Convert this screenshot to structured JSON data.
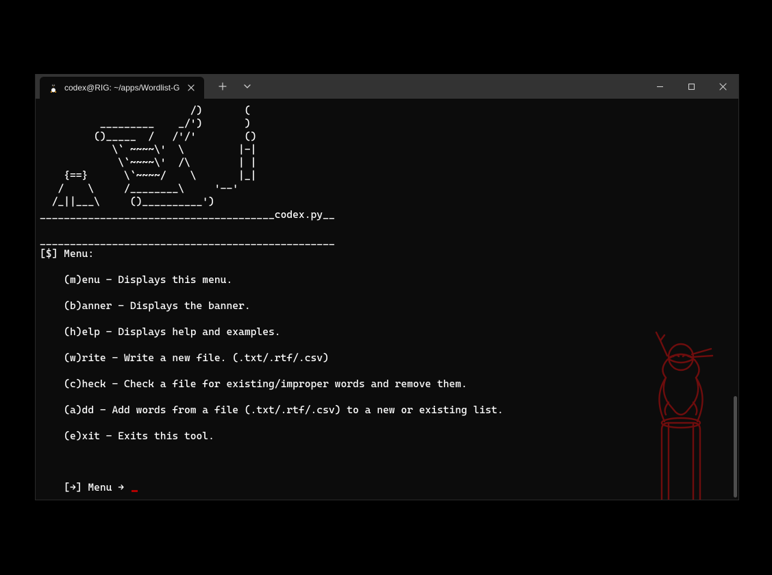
{
  "window": {
    "tab_title": "codex@RIG: ~/apps/Wordlist-G",
    "new_tab_aria": "New tab",
    "tab_dropdown_aria": "Tab options",
    "minimize_aria": "Minimize",
    "maximize_aria": "Maximize",
    "close_aria": "Close"
  },
  "terminal": {
    "ascii_banner": "                         /)       (\n          _________    _/')       )\n         ()_____  /   /'/'        ()\n            \\` ~~~~\\'  \\         |-|\n             \\`~~~~\\'  /\\        | |\n    {==}      \\`~~~~/    \\       |_|\n   /    \\     /________\\     '--'\n  /_||___\\     ()__________')\n_______________________________________codex.py__\n\n_________________________________________________",
    "menu_header": "[$] Menu:",
    "menu_items": [
      "(m)enu - Displays this menu.",
      "(b)anner - Displays the banner.",
      "(h)elp - Displays help and examples.",
      "(w)rite - Write a new file. (.txt/.rtf/.csv)",
      "(c)heck - Check a file for existing/improper words and remove them.",
      "(a)dd - Add words from a file (.txt/.rtf/.csv) to a new or existing list.",
      "(e)xit - Exits this tool."
    ],
    "prompt": "    [→] Menu → "
  },
  "colors": {
    "bg": "#000000",
    "terminal_bg": "#0c0c0c",
    "titlebar_bg": "#333333",
    "text": "#ffffff",
    "accent_red": "#8a0e0e"
  }
}
